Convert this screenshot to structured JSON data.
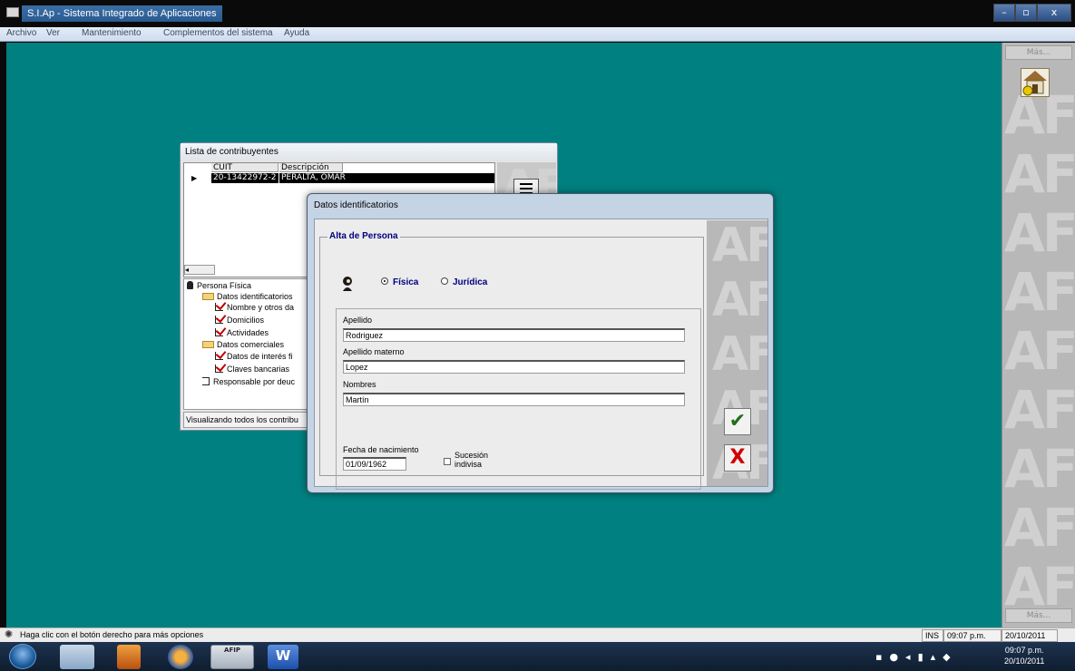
{
  "window": {
    "title": "S.I.Ap - Sistema Integrado de Aplicaciones",
    "min_glyph": "–",
    "max_glyph": "▫",
    "close_glyph": "x"
  },
  "menu": [
    "Archivo",
    "Ver",
    "Mantenimiento",
    "Complementos del sistema",
    "Ayuda"
  ],
  "side_panel": {
    "mas_top": "Más...",
    "mas_bottom": "Más..."
  },
  "lista": {
    "title": "Lista de contribuyentes",
    "columns": [
      "CUIT",
      "Descripción"
    ],
    "rows": [
      {
        "cuit": "20-13422972-2",
        "descripcion": "PERALTA, OMAR"
      }
    ],
    "tree": {
      "root": "Persona Física",
      "datos_identificatorios": "Datos identificatorios",
      "nombre": "Nombre y otros da",
      "domicilios": "Domicilios",
      "actividades": "Actividades",
      "datos_comerciales": "Datos comerciales",
      "datos_interes": "Datos de interés fi",
      "claves": "Claves bancarias",
      "responsable": "Responsable por deuc"
    },
    "status": "Visualizando todos los contribu"
  },
  "dialog": {
    "title": "Datos identificatorios",
    "group": "Alta de Persona",
    "radio_fisica": "Física",
    "radio_juridica": "Jurídica",
    "apellido_label": "Apellido",
    "apellido_value": "Rodriguez",
    "apellido_materno_label": "Apellido materno",
    "apellido_materno_value": "Lopez",
    "nombres_label": "Nombres",
    "nombres_value": "Martín",
    "fecha_label": "Fecha de nacimiento",
    "fecha_value": "01/09/1962",
    "sucesion_line1": "Sucesión",
    "sucesion_line2": "indivisa",
    "ok_glyph": "✔",
    "cancel_glyph": "X"
  },
  "statusbar": {
    "hint": "Haga clic con el botón derecho para más opciones",
    "ins": "INS",
    "time": "09:07 p.m.",
    "date": "20/10/2011"
  },
  "taskbar": {
    "siap_label": "AFIP",
    "word_label": "W",
    "clock_time": "09:07 p.m.",
    "clock_date": "20/10/2011"
  },
  "colors": {
    "workspace": "#008080",
    "accent_blue": "#000080",
    "ok_green": "#1f6f1f",
    "cancel_red": "#d00000"
  }
}
